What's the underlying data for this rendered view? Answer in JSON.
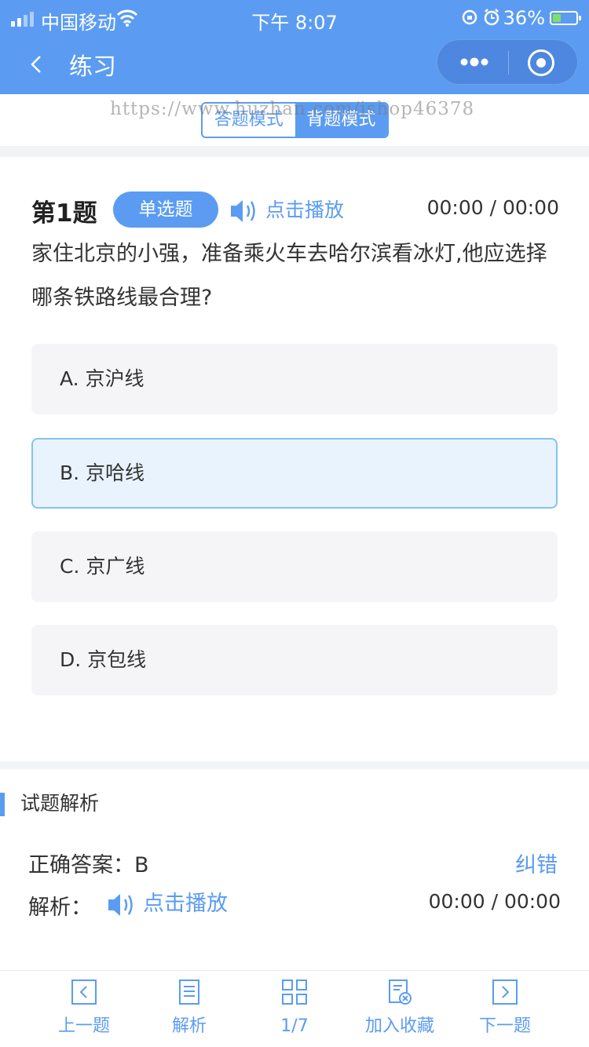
{
  "status_bar": {
    "carrier": "中国移动",
    "time": "下午 8:07",
    "battery_pct": "36%",
    "battery_level": 0.36
  },
  "nav": {
    "title": "练习"
  },
  "mode": {
    "answer_mode": "答题模式",
    "memorize_mode": "背题模式",
    "active": "memorize"
  },
  "watermark": "https://www.huzhan.com/ishop46378",
  "question": {
    "number_label": "第1题",
    "type_label": "单选题",
    "play_label": "点击播放",
    "time": "00:00 / 00:00",
    "text": "家住北京的小强，准备乘火车去哈尔滨看冰灯,他应选择哪条铁路线最合理?",
    "options": [
      {
        "label": "A. 京沪线",
        "selected": false
      },
      {
        "label": "B. 京哈线",
        "selected": true
      },
      {
        "label": "C. 京广线",
        "selected": false
      },
      {
        "label": "D. 京包线",
        "selected": false
      }
    ]
  },
  "analysis": {
    "title": "试题解析",
    "answer": "正确答案：B",
    "report_label": "纠错",
    "explain_label": "解析：",
    "play_label": "点击播放",
    "time": "00:00 / 00:00"
  },
  "tabbar": {
    "items": [
      {
        "label": "上一题",
        "icon": "prev-icon"
      },
      {
        "label": "解析",
        "icon": "document-icon"
      },
      {
        "label": "1/7",
        "icon": "grid-icon"
      },
      {
        "label": "加入收藏",
        "icon": "favorite-icon"
      },
      {
        "label": "下一题",
        "icon": "next-icon"
      }
    ]
  },
  "colors": {
    "brand": "#5b9cf2",
    "selected_bg": "#e8f3fd",
    "selected_border": "#85c3ec",
    "option_bg": "#f5f5f7"
  }
}
